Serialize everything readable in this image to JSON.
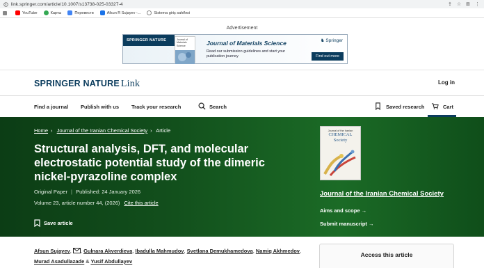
{
  "browser": {
    "url": "link.springer.com/article/10.1007/s13738-025-03327-4",
    "bookmarks": [
      {
        "label": "YouTube",
        "color": "#ff0000"
      },
      {
        "label": "Карты",
        "color": "#34a853"
      },
      {
        "label": "Перевести",
        "color": "#4285f4"
      },
      {
        "label": "Afsun R Sujayev -...",
        "color": "#1a73e8"
      },
      {
        "label": "Sistema giriş sahifəsi",
        "color": "#888888"
      }
    ]
  },
  "advert": {
    "label": "Advertisement",
    "brand": "SPRINGER NATURE",
    "cover_title": "Journal of Materials Science",
    "journal": "Journal of Materials Science",
    "text": "Read our submission guidelines and start your publication journey",
    "publisher": "Springer",
    "cta": "Find out more"
  },
  "header": {
    "logo_brand": "SPRINGER NATURE",
    "logo_link": "Link",
    "login": "Log in"
  },
  "nav": {
    "find_journal": "Find a journal",
    "publish": "Publish with us",
    "track": "Track your research",
    "search": "Search",
    "saved": "Saved research",
    "cart": "Cart"
  },
  "breadcrumb": {
    "home": "Home",
    "journal": "Journal of the Iranian Chemical Society",
    "current": "Article"
  },
  "article": {
    "title": "Structural analysis, DFT, and molecular electrostatic potential study of the dimeric nickel-pyrazoline complex",
    "type": "Original Paper",
    "published": "Published: 24 January 2026",
    "volume": "Volume 23, article number 44, (2026)",
    "cite": "Cite this article",
    "save": "Save article"
  },
  "journal_panel": {
    "cover_head": "Journal of the Iranian",
    "cover_title_1": "CHEMICAL",
    "cover_title_2": "Society",
    "name": "Journal of the Iranian Chemical Society",
    "aims": "Aims and scope →",
    "submit": "Submit manuscript →"
  },
  "authors": {
    "list": [
      "Afsun Sujayev",
      "Gulnara Akverdieva",
      "Ibadulla Mahmudov",
      "Svetlana Demukhamedova",
      "Namiq Akhmedov",
      "Murad Asadullazade",
      "Yusif Abdullayev"
    ],
    "separator": ",",
    "amp": "&"
  },
  "access": {
    "title": "Access this article"
  },
  "colors": {
    "brand": "#0b3c5d",
    "hero_green": "#124f1c"
  }
}
